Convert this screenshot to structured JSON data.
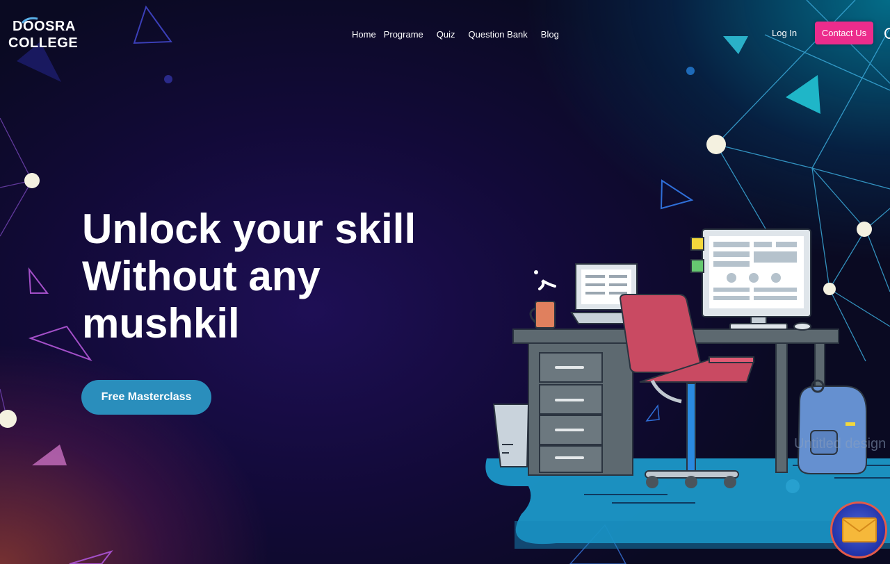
{
  "header": {
    "logo_line1": "DOOSRA",
    "logo_line2": "COLLEGE",
    "nav": [
      {
        "label": "Home"
      },
      {
        "label": "Programe"
      },
      {
        "label": "Quiz"
      },
      {
        "label": "Question Bank"
      },
      {
        "label": "Blog"
      }
    ],
    "login_label": "Log In",
    "contact_label": "Contact Us"
  },
  "hero": {
    "title_lines": [
      "Unlock your skill",
      "Without any",
      "mushkil"
    ],
    "cta_label": "Free Masterclass"
  },
  "illustration": {
    "watermark": "Untitled design"
  },
  "colors": {
    "accent_pink": "#ec2c8c",
    "cta_blue": "#2a8ebc",
    "bg_dark": "#120a38",
    "mail_blue": "#2a3fba"
  },
  "icons": {
    "mail_button": "envelope-icon",
    "search": "search-icon"
  }
}
